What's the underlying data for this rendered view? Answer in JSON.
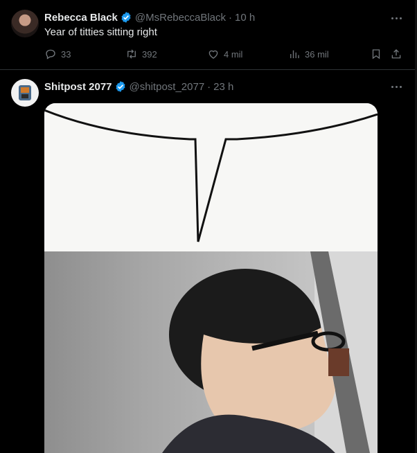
{
  "tweets": [
    {
      "name": "Rebecca Black",
      "handle": "@MsRebeccaBlack",
      "separator": "·",
      "time": "10 h",
      "text": "Year of titties sitting right",
      "actions": {
        "replies": "33",
        "reposts": "392",
        "likes": "4 mil",
        "views": "36 mil"
      }
    },
    {
      "name": "Shitpost 2077",
      "handle": "@shitpost_2077",
      "separator": "·",
      "time": "23 h"
    }
  ],
  "icons": {
    "verified": "verified-badge-icon",
    "more": "more-dots-icon",
    "reply": "reply-icon",
    "repost": "repost-icon",
    "like": "heart-icon",
    "views": "views-icon",
    "bookmark": "bookmark-icon",
    "share": "share-icon"
  },
  "colors": {
    "background": "#000000",
    "verified": "#1d9bf0",
    "muted": "#71767b",
    "text": "#e7e9ea",
    "divider": "#2f3336"
  }
}
